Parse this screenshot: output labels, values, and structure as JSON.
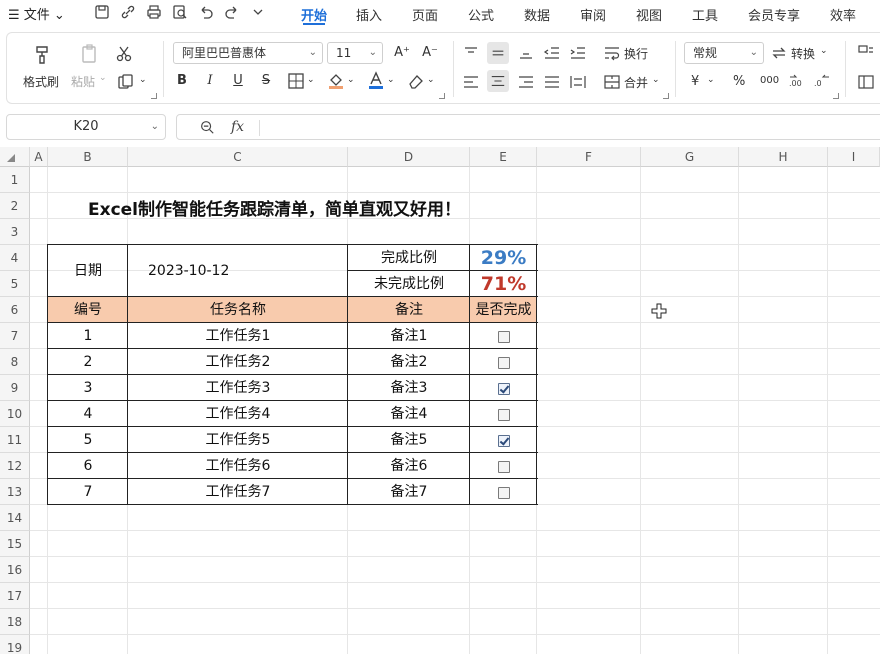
{
  "menubar": {
    "file_label": "☰ 文件 ⌄",
    "tabs": [
      {
        "label": "开始",
        "active": true
      },
      {
        "label": "插入"
      },
      {
        "label": "页面"
      },
      {
        "label": "公式"
      },
      {
        "label": "数据"
      },
      {
        "label": "审阅"
      },
      {
        "label": "视图"
      },
      {
        "label": "工具"
      },
      {
        "label": "会员专享"
      },
      {
        "label": "效率"
      }
    ]
  },
  "ribbon": {
    "format_painter": "格式刷",
    "paste": "粘贴",
    "font_name": "阿里巴巴普惠体",
    "font_size": "11",
    "wrap_text": "换行",
    "merge": "合并",
    "number_format": "常规",
    "convert": "转换",
    "currency_symbol": "¥",
    "percent_symbol": "%",
    "thousands_symbol": "000",
    "bold": "B",
    "italic": "I",
    "underline": "U",
    "strike": "S",
    "increase_font": "A⁺",
    "decrease_font": "A⁻"
  },
  "formula_bar": {
    "name_box": "K20",
    "fx_label": "fx",
    "formula": ""
  },
  "columns": [
    "A",
    "B",
    "C",
    "D",
    "E",
    "F",
    "G",
    "H",
    "I"
  ],
  "rows": [
    "1",
    "2",
    "3",
    "4",
    "5",
    "6",
    "7",
    "8",
    "9",
    "10",
    "11",
    "12",
    "13",
    "14",
    "15",
    "16",
    "17",
    "18",
    "19"
  ],
  "sheet": {
    "title": "Excel制作智能任务跟踪清单，简单直观又好用！",
    "date_label": "日期",
    "date_value": "2023-10-12",
    "done_label": "完成比例",
    "done_value": "29%",
    "undone_label": "未完成比例",
    "undone_value": "71%",
    "done_color": "#3b7cc4",
    "undone_color": "#c0392b",
    "header_fill": "#f8cbad",
    "headers": {
      "id": "编号",
      "name": "任务名称",
      "note": "备注",
      "done": "是否完成"
    },
    "tasks": [
      {
        "id": "1",
        "name": "工作任务1",
        "note": "备注1",
        "done": false
      },
      {
        "id": "2",
        "name": "工作任务2",
        "note": "备注2",
        "done": false
      },
      {
        "id": "3",
        "name": "工作任务3",
        "note": "备注3",
        "done": true
      },
      {
        "id": "4",
        "name": "工作任务4",
        "note": "备注4",
        "done": false
      },
      {
        "id": "5",
        "name": "工作任务5",
        "note": "备注5",
        "done": true
      },
      {
        "id": "6",
        "name": "工作任务6",
        "note": "备注6",
        "done": false
      },
      {
        "id": "7",
        "name": "工作任务7",
        "note": "备注7",
        "done": false
      }
    ]
  }
}
